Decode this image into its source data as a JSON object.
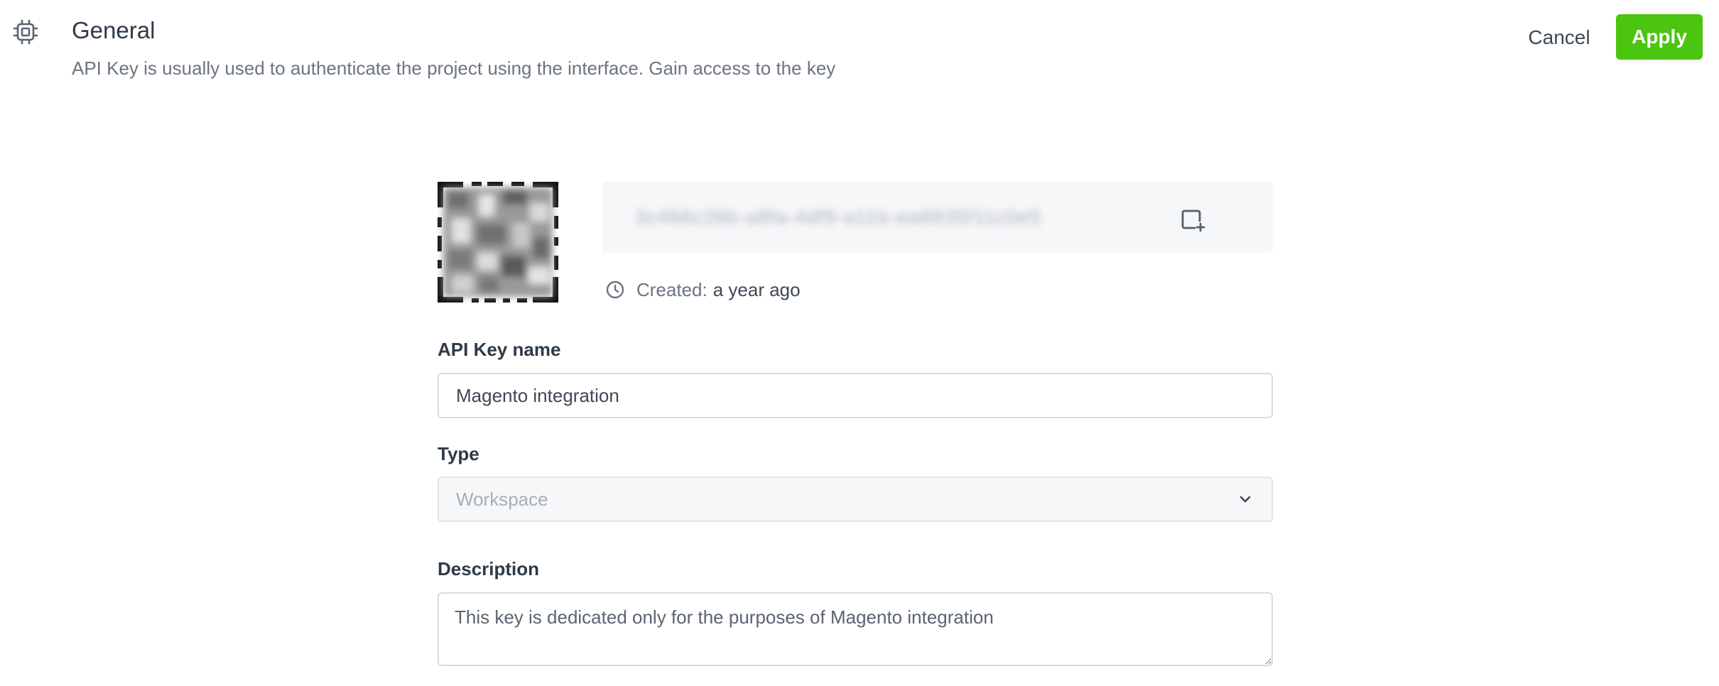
{
  "header": {
    "section_icon": "chip-icon",
    "title": "General",
    "subtitle": "API Key is usually used to authenticate the project using the interface. Gain access to the key",
    "cancel_label": "Cancel",
    "apply_label": "Apply"
  },
  "key": {
    "qr_icon": "qr-code-image",
    "masked_value": "3c466c26b-a8fa-4df9-a11b-ea6835f11c0e5",
    "copy_icon": "copy-icon",
    "created_icon": "clock-icon",
    "created_label": "Created:",
    "created_value": "a year ago"
  },
  "form": {
    "name_label": "API Key name",
    "name_value": "Magento integration",
    "type_label": "Type",
    "type_value": "Workspace",
    "type_icon": "chevron-down-icon",
    "description_label": "Description",
    "description_value": "This key is dedicated only for the purposes of Magento integration"
  },
  "colors": {
    "accent": "#4cc510",
    "text_primary": "#2f3a47",
    "text_secondary": "#6b7480",
    "border": "#d7dbe0",
    "panel_bg": "#f6f7f9"
  }
}
